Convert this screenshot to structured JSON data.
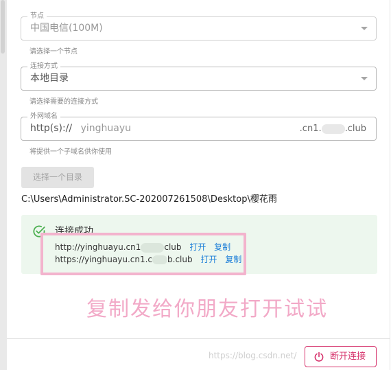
{
  "node_field": {
    "legend": "节点",
    "value": "中国电信(100M)",
    "helper": "请选择一个节点"
  },
  "method_field": {
    "legend": "连接方式",
    "value": "本地目录",
    "helper": "请选择需要的连接方式"
  },
  "domain_field": {
    "legend": "外网域名",
    "prefix": "http(s)://",
    "subdomain": "yinghuayu",
    "suffix_start": ".cn1.",
    "suffix_end": ".club",
    "helper": "将提供一个子域名供你使用"
  },
  "select_dir_button": "选择一个目录",
  "selected_path": "C:\\Users\\Administrator.SC-202007261508\\Desktop\\樱花雨",
  "success": {
    "title": "连接成功",
    "urls": [
      {
        "start": "http://yinghuayu.cn1",
        "end": "club",
        "open": "打开",
        "copy": "复制"
      },
      {
        "start": "https://yinghuayu.cn1.c",
        "end": "b.club",
        "open": "打开",
        "copy": "复制"
      }
    ]
  },
  "annotation": "复制发给你朋友打开试试",
  "watermark": "https://blog.csdn.net/",
  "disconnect_button": "断开连接",
  "colors": {
    "success_bg": "#edf7ee",
    "success_icon": "#4caf50",
    "link": "#1e7fd8",
    "danger": "#d6336c",
    "annotation_pink": "#f2a9c7"
  },
  "icons": {
    "select_caret": "chevron-down-icon",
    "success": "check-circle-icon",
    "disconnect": "power-icon"
  }
}
